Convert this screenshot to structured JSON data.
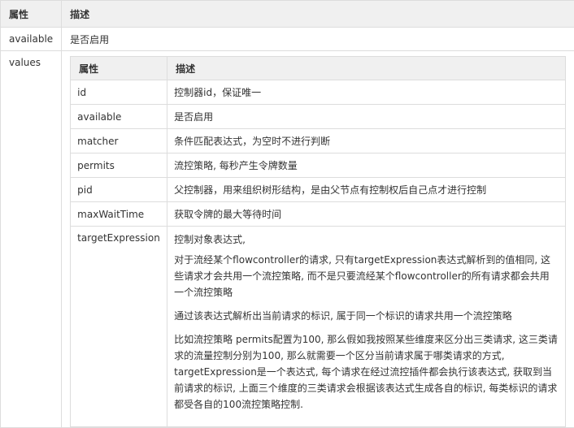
{
  "outer": {
    "header": {
      "key": "属性",
      "desc": "描述"
    },
    "available": {
      "key": "available",
      "desc": "是否启用"
    },
    "values": {
      "key": "values"
    }
  },
  "inner": {
    "header": {
      "key": "属性",
      "desc": "描述"
    },
    "rows": [
      {
        "key": "id",
        "desc": "控制器id，保证唯一"
      },
      {
        "key": "available",
        "desc": "是否启用"
      },
      {
        "key": "matcher",
        "desc": "条件匹配表达式，为空时不进行判断"
      },
      {
        "key": "permits",
        "desc": "流控策略, 每秒产生令牌数量"
      },
      {
        "key": "pid",
        "desc": "父控制器，用来组织树形结构，是由父节点有控制权后自己点才进行控制"
      },
      {
        "key": "maxWaitTime",
        "desc": "获取令牌的最大等待时间"
      }
    ],
    "target": {
      "key": "targetExpression",
      "paragraphs": [
        "控制对象表达式,",
        "对于流经某个flowcontroller的请求, 只有targetExpression表达式解析到的值相同, 这些请求才会共用一个流控策略, 而不是只要流经某个flowcontroller的所有请求都会共用一个流控策略",
        "通过该表达式解析出当前请求的标识, 属于同一个标识的请求共用一个流控策略",
        "比如流控策略 permits配置为100, 那么假如我按照某些维度来区分出三类请求, 这三类请求的流量控制分别为100, 那么就需要一个区分当前请求属于哪类请求的方式, targetExpression是一个表达式, 每个请求在经过流控插件都会执行该表达式, 获取到当前请求的标识, 上面三个维度的三类请求会根据该表达式生成各自的标识, 每类标识的请求都受各自的100流控策略控制."
      ]
    }
  }
}
